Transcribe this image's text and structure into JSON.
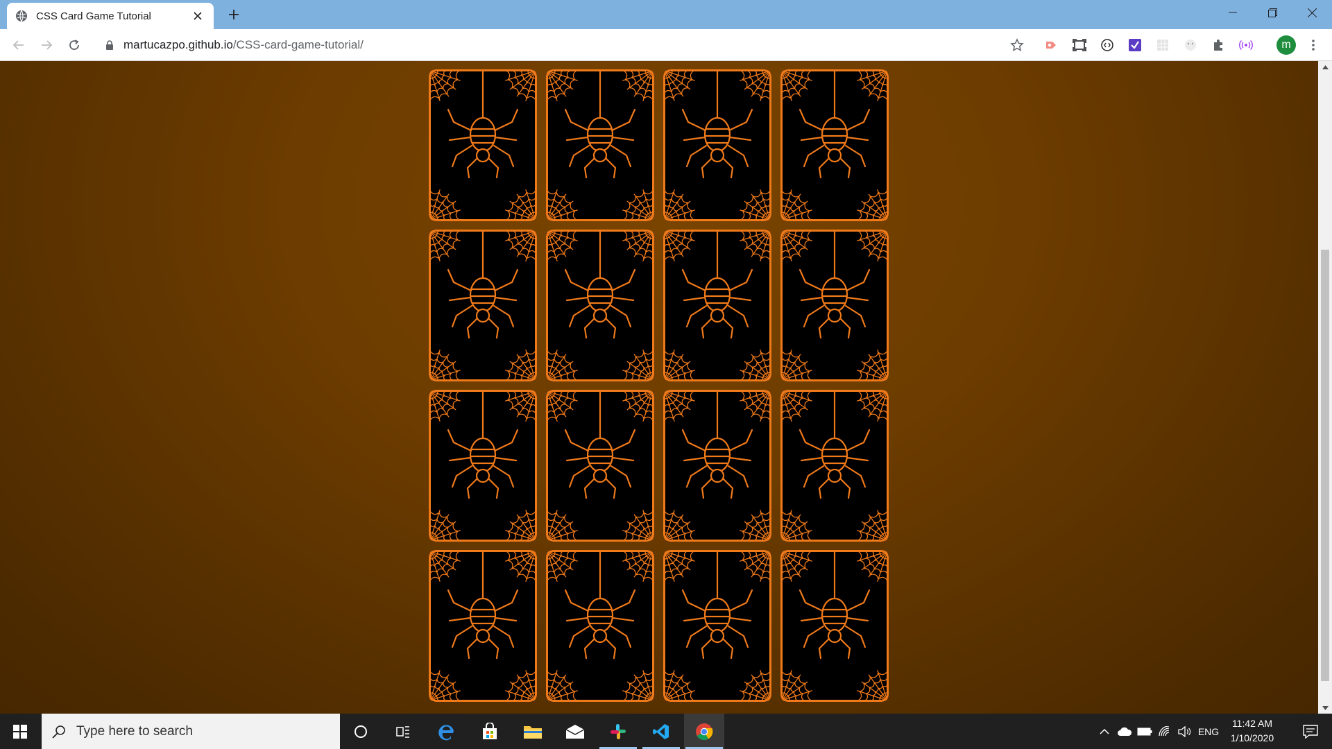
{
  "browser": {
    "tab_title": "CSS Card Game Tutorial",
    "url_host": "martucazpo.github.io",
    "url_path": "/CSS-card-game-tutorial/",
    "profile_initial": "m"
  },
  "page": {
    "card_rows": 4,
    "card_columns": 4,
    "card_back": "spider-and-cobweb pattern",
    "colors": {
      "accent": "#f07a1a",
      "card_face": "#000000",
      "background": "#6f3e00"
    }
  },
  "taskbar": {
    "search_placeholder": "Type here to search",
    "language": "ENG",
    "time": "11:42 AM",
    "date": "1/10/2020"
  }
}
